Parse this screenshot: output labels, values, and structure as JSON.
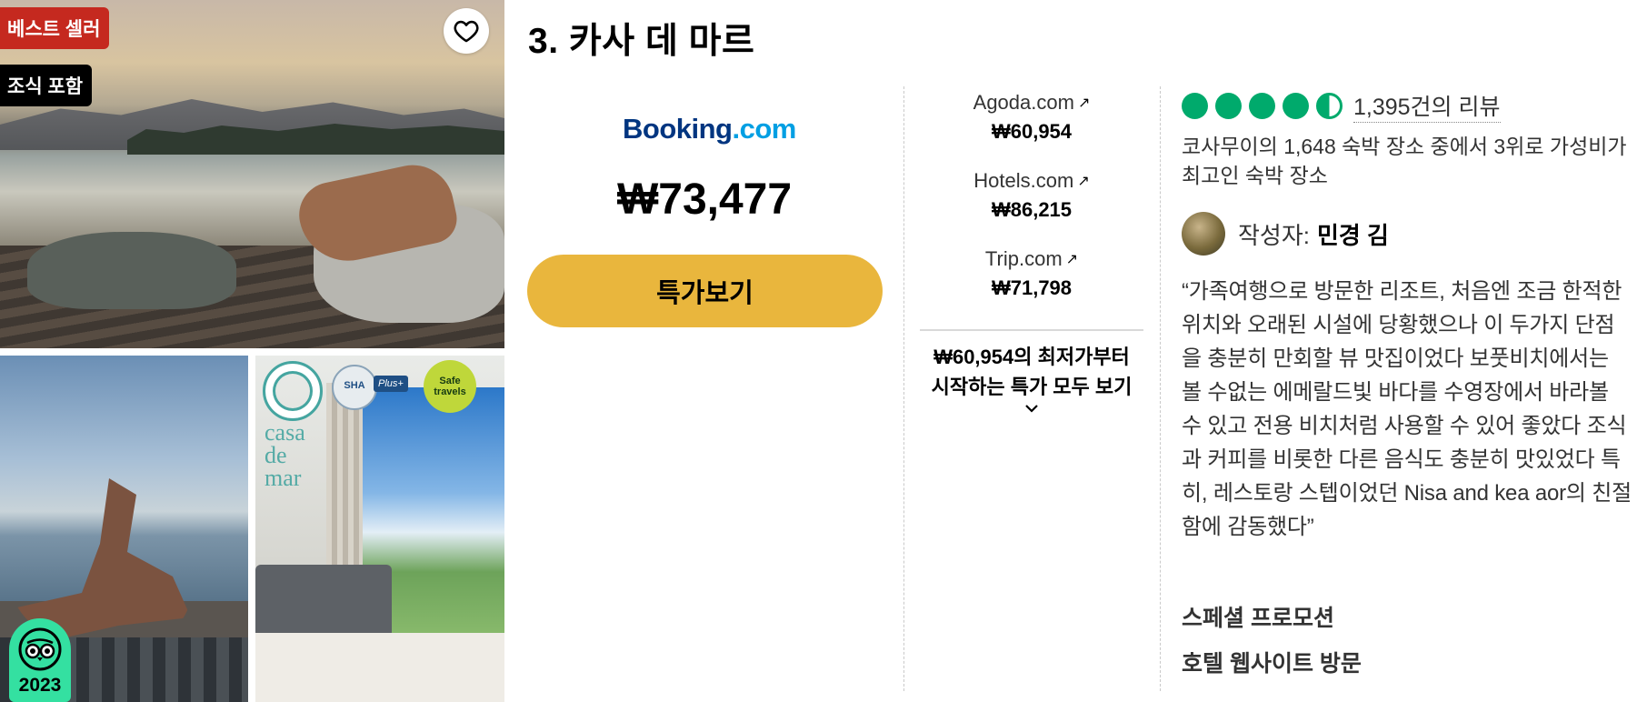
{
  "badges": {
    "bestseller": "베스트 셀러",
    "breakfast": "조식 포함",
    "award_year": "2023"
  },
  "photo_logos": {
    "hotel_brand": "casa de mar",
    "sha": "SHA",
    "sha_plus": "Plus+",
    "safe_travels": "Safe travels"
  },
  "listing": {
    "title": "3. 카사 데 마르"
  },
  "main_offer": {
    "provider": "Booking",
    "provider_tld": ".com",
    "price": "₩73,477",
    "button_label": "특가보기"
  },
  "other_offers": [
    {
      "provider": "Agoda.com",
      "price": "₩60,954"
    },
    {
      "provider": "Hotels.com",
      "price": "₩86,215"
    },
    {
      "provider": "Trip.com",
      "price": "₩71,798"
    }
  ],
  "all_deals": {
    "line1": "₩60,954의 최저가부터",
    "line2": "시작하는 특가 모두 보기"
  },
  "review": {
    "rating": 4.5,
    "count_label": "1,395건의 리뷰",
    "rank_text": "코사무이의  1,648 숙박 장소 중에서 3위로 가성비가 최고인 숙박 장소",
    "author_prefix": "작성자:",
    "author_name": "민경 김",
    "quote": "“가족여행으로 방문한 리조트, 처음엔 조금 한적한 위치와 오래된 시설에 당황했으나 이 두가지 단점을 충분히 만회할 뷰 맛집이었다 보풋비치에서는 볼 수없는 에메랄드빛 바다를 수영장에서 바라볼 수 있고 전용 비치처럼 사용할 수 있어 좋았다 조식과 커피를 비롯한 다른 음식도 충분히 맛있었다 특히, 레스토랑 스텝이었던 Nisa and kea aor의 친절함에 감동했다”"
  },
  "links": {
    "special_promotion": "스페셜 프로모션",
    "hotel_website": "호텔 웹사이트 방문"
  },
  "colors": {
    "accent_button": "#e9b63d",
    "rating_green": "#00aa6c",
    "bestseller_red": "#c5291f",
    "booking_blue": "#003580"
  }
}
